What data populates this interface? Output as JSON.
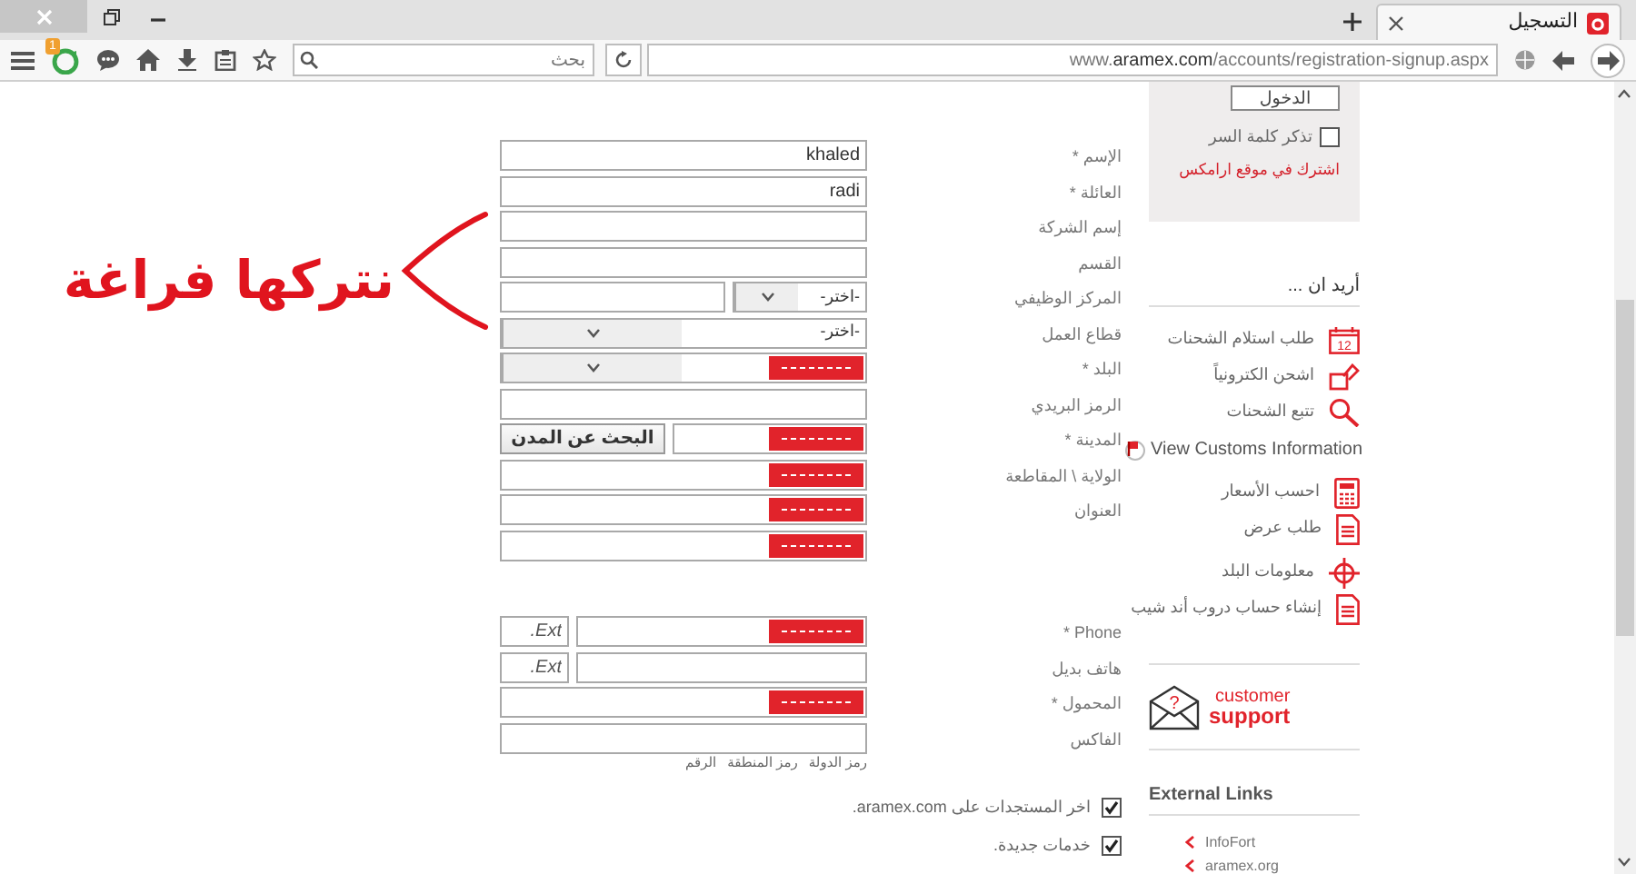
{
  "browser": {
    "tab": {
      "title": "التسجيل"
    }
  },
  "toolbar": {
    "notification_count": "1",
    "search": {
      "placeholder": "بحث"
    },
    "url": "www.**aramex.com**/accounts/registration-signup.aspx"
  },
  "annotation": {
    "text": "نتركها فراغة"
  },
  "form": {
    "address_rows": [
      {
        "label": "الإسم *",
        "kind": "text",
        "value": "khaled",
        "error": false
      },
      {
        "label": "العائلة *",
        "kind": "text",
        "value": "radi",
        "error": false
      },
      {
        "label": "إسم الشركة",
        "kind": "text",
        "error": false
      },
      {
        "label": "القسم",
        "kind": "text",
        "error": false
      },
      {
        "label": "المركز الوظيفي",
        "kind": "select_pair",
        "value": "-اختر-",
        "error": false
      },
      {
        "label": "قطاع العمل",
        "kind": "select",
        "value": "-اختر-",
        "error": false
      },
      {
        "label": "البلد *",
        "kind": "select",
        "error": true
      },
      {
        "label": "الرمز البريدي",
        "kind": "text",
        "error": false
      },
      {
        "label": "المدينة *",
        "kind": "city",
        "button": "البحث عن المدن",
        "error": true
      },
      {
        "label": "الولاية \\ المقاطعة",
        "kind": "text",
        "error": true
      },
      {
        "label": "العنوان",
        "kind": "text",
        "error": true
      },
      {
        "kind": "text",
        "error": true
      }
    ],
    "contact_rows": [
      {
        "label": "Phone *",
        "kind": "phone",
        "ext_placeholder": "Ext.",
        "error": true
      },
      {
        "label": "هاتف بديل",
        "kind": "phone",
        "ext_placeholder": "Ext.",
        "error": false
      },
      {
        "label": "المحمول *",
        "kind": "text",
        "error": true
      },
      {
        "label": "الفاكس",
        "kind": "text",
        "error": false
      }
    ],
    "hints": [
      "رمز الدولة",
      "رمز المنطقة",
      "الرقم"
    ],
    "options": [
      {
        "label": "اخر المستجدات على aramex.com.",
        "checked": true
      },
      {
        "label": "خدمات جديدة.",
        "checked": true
      }
    ]
  },
  "sidebar": {
    "login": {
      "button": "الدخول",
      "remember": {
        "label": "تذكر كلمة السر",
        "checked": false
      },
      "signup_link": "اشترك في موقع ارامكس"
    },
    "actions": {
      "heading": "أريد ان ...",
      "items": [
        {
          "label": "طلب استلام الشحنات",
          "icon_text": "12",
          "kind": "link"
        },
        {
          "label": "اشحن الكترونياً",
          "kind": "link"
        },
        {
          "label": "تتبع الشحنات",
          "kind": "link"
        },
        {
          "label": "View Customs Information",
          "kind": "wide"
        },
        {
          "label": "احسب الأسعار",
          "kind": "link"
        },
        {
          "label": "طلب عرض",
          "kind": "link"
        },
        {
          "label": "معلومات البلد",
          "kind": "link"
        },
        {
          "label": "إنشاء حساب دروب أند شيب",
          "kind": "link"
        }
      ]
    },
    "support": {
      "symbol": "?",
      "lines": [
        "customer",
        "support"
      ]
    },
    "external_links": {
      "heading": "External Links",
      "items": [
        "InfoFort",
        "aramex.org"
      ]
    }
  }
}
